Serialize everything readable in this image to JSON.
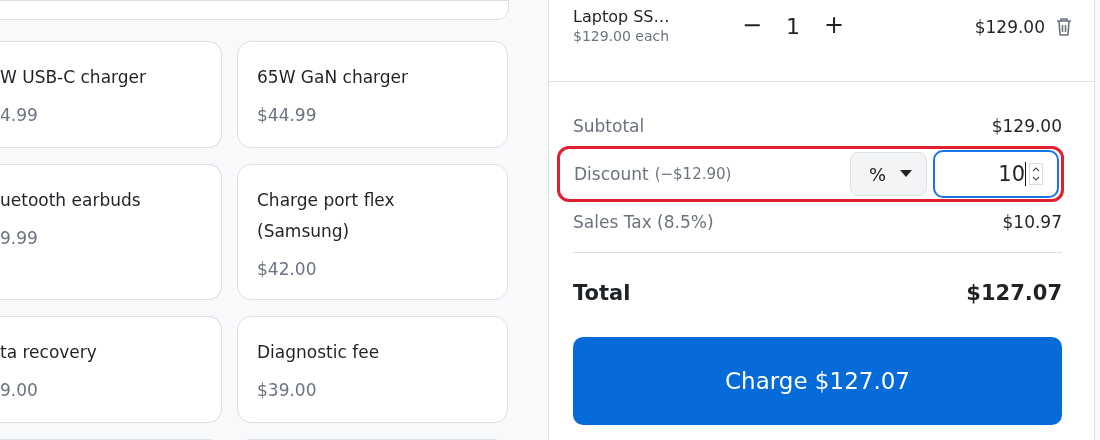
{
  "products": [
    {
      "name": "W USB-C charger",
      "price": "4.99",
      "cut": true
    },
    {
      "name": "65W GaN charger",
      "price": "$44.99",
      "cut": false
    },
    {
      "name": "uetooth earbuds",
      "price": "9.99",
      "cut": true
    },
    {
      "name": "Charge port flex (Samsung)",
      "price": "$42.00",
      "cut": false
    },
    {
      "name": "ta recovery",
      "price": "9.00",
      "cut": true
    },
    {
      "name": "Diagnostic fee",
      "price": "$39.00",
      "cut": false
    }
  ],
  "cart": {
    "items": [
      {
        "name": "Laptop SS…",
        "unit_price": "$129.00 each",
        "decrease": "−",
        "quantity": "1",
        "increase": "+",
        "line_total": "$129.00"
      }
    ]
  },
  "summary": {
    "subtotal_label": "Subtotal",
    "subtotal": "$129.00",
    "discount": {
      "label": "Discount",
      "amount": "(−$12.90)",
      "type": "%",
      "value": "10",
      "focused": true,
      "highlighted": true
    },
    "tax_label": "Sales Tax (8.5%)",
    "tax": "$10.97",
    "total_label": "Total",
    "total": "$127.07"
  },
  "charge_button": "Charge $127.07"
}
